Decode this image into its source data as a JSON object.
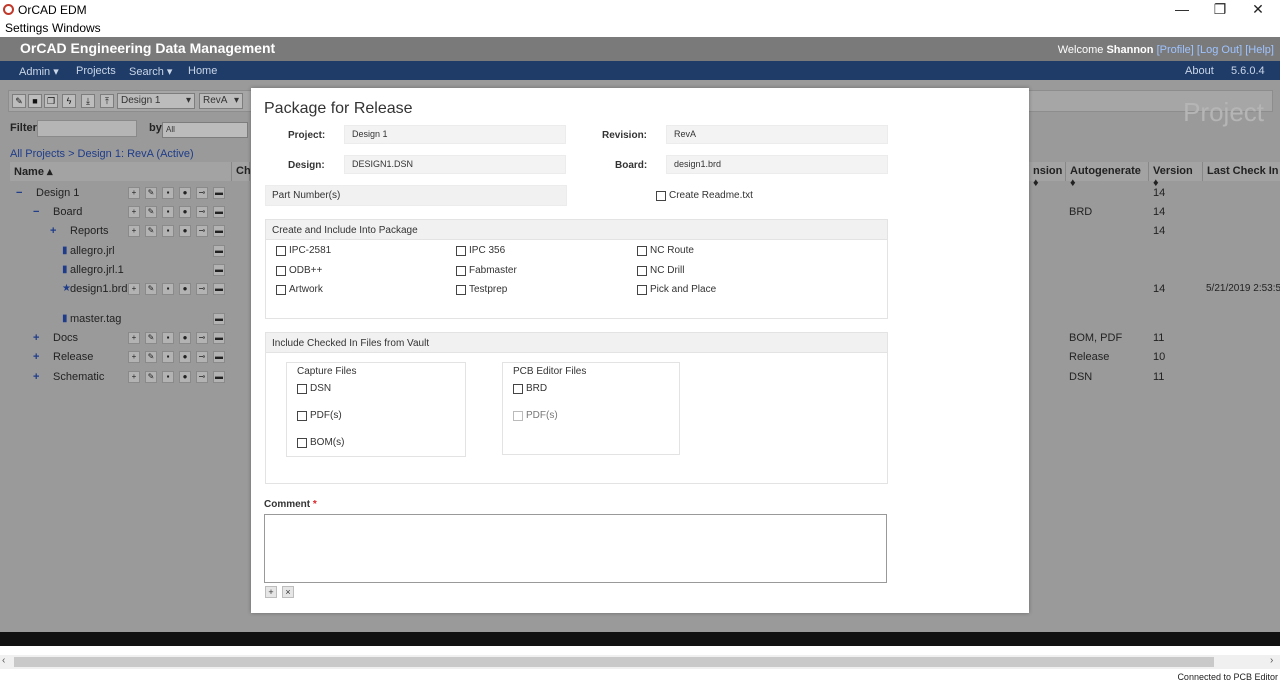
{
  "window": {
    "title": "OrCAD EDM",
    "controls": [
      "—",
      "❐",
      "✕"
    ]
  },
  "menubar": [
    "Settings",
    "Windows"
  ],
  "header": {
    "app_title": "OrCAD Engineering Data Management",
    "welcome": "Welcome",
    "user": "Shannon",
    "links": [
      "[Profile]",
      "[Log Out]",
      "[Help]"
    ]
  },
  "navbar": {
    "left": [
      "Admin ▾",
      "Projects",
      "Search ▾",
      "Home"
    ],
    "about": "About",
    "version": "5.6.0.4"
  },
  "background": {
    "design_select": "Design 1",
    "rev_select": "RevA",
    "project_watermark": "Project",
    "filter_label": "Filter",
    "by_label": "by",
    "by_value": "All",
    "breadcrumb": "All Projects > Design 1: RevA (Active)",
    "name_header": "Name ▴",
    "partial_header": "Ch",
    "tree": [
      {
        "expander": "−",
        "icon": "",
        "label": "Design 1",
        "indent": 0,
        "has_btns": true
      },
      {
        "expander": "−",
        "icon": "",
        "label": "Board",
        "indent": 1,
        "has_btns": true
      },
      {
        "expander": "+",
        "icon": "",
        "label": "Reports",
        "indent": 2,
        "has_btns": true
      },
      {
        "expander": "",
        "icon": "file",
        "label": "allegro.jrl",
        "indent": 2,
        "has_btns": false
      },
      {
        "expander": "",
        "icon": "file",
        "label": "allegro.jrl.1",
        "indent": 2,
        "has_btns": false
      },
      {
        "expander": "",
        "icon": "star",
        "label": "design1.brd",
        "indent": 2,
        "has_btns": true
      },
      {
        "expander": "",
        "icon": "file",
        "label": "master.tag",
        "indent": 2,
        "has_btns": false
      },
      {
        "expander": "+",
        "icon": "",
        "label": "Docs",
        "indent": 1,
        "has_btns": true
      },
      {
        "expander": "+",
        "icon": "",
        "label": "Release",
        "indent": 1,
        "has_btns": true
      },
      {
        "expander": "+",
        "icon": "",
        "label": "Schematic",
        "indent": 1,
        "has_btns": true
      }
    ],
    "grid_headers": [
      "nsion ♦",
      "Autogenerate ♦",
      "Version ♦",
      "Last Check In D"
    ],
    "grid_rows": [
      {
        "auto": "",
        "version": "14",
        "checkin": ""
      },
      {
        "auto": "BRD",
        "version": "14",
        "checkin": ""
      },
      {
        "auto": "",
        "version": "14",
        "checkin": ""
      },
      {
        "auto": "",
        "version": "",
        "checkin": ""
      },
      {
        "auto": "",
        "version": "",
        "checkin": ""
      },
      {
        "auto": "",
        "version": "14",
        "checkin": "5/21/2019 2:53:5"
      },
      {
        "auto": "",
        "version": "",
        "checkin": ""
      },
      {
        "auto": "BOM, PDF",
        "version": "11",
        "checkin": ""
      },
      {
        "auto": "Release",
        "version": "10",
        "checkin": ""
      },
      {
        "auto": "DSN",
        "version": "11",
        "checkin": ""
      }
    ]
  },
  "modal": {
    "title": "Package for Release",
    "project_label": "Project:",
    "project_value": "Design 1",
    "revision_label": "Revision:",
    "revision_value": "RevA",
    "design_label": "Design:",
    "design_value": "DESIGN1.DSN",
    "board_label": "Board:",
    "board_value": "design1.brd",
    "part_numbers_label": "Part Number(s)",
    "create_readme_label": "Create Readme.txt",
    "package_section_title": "Create and Include Into Package",
    "package_options": [
      [
        "IPC-2581",
        "IPC 356",
        "NC Route"
      ],
      [
        "ODB++",
        "Fabmaster",
        "NC Drill"
      ],
      [
        "Artwork",
        "Testprep",
        "Pick and Place"
      ]
    ],
    "vault_section_title": "Include Checked In Files from Vault",
    "capture_files": {
      "title": "Capture Files",
      "items": [
        "DSN",
        "PDF(s)",
        "BOM(s)"
      ]
    },
    "pcb_files": {
      "title": "PCB Editor Files",
      "items": [
        "BRD",
        "PDF(s)"
      ]
    },
    "comment_label": "Comment",
    "comment_required": "*",
    "comment_value": ""
  },
  "status": {
    "text": "Connected to PCB Editor"
  }
}
